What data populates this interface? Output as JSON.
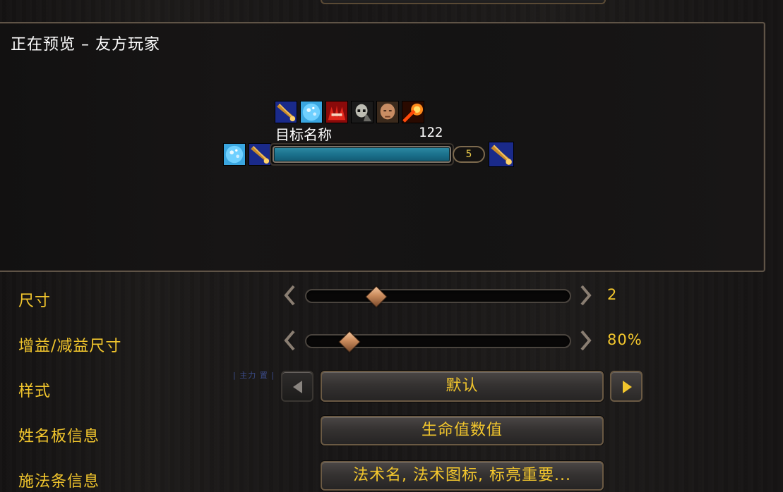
{
  "preview": {
    "title": "正在预览 – 友方玩家",
    "target_name": "目标名称",
    "target_level": "122",
    "stack_count": "5",
    "buff_icons": [
      "blue-staff-icon",
      "frost-orb-icon",
      "red-demon-icon",
      "armored-skull-icon",
      "bald-ogre-icon",
      "fire-burst-icon"
    ],
    "left_icons": [
      "frost-orb-icon",
      "blue-staff-icon"
    ],
    "right_icons": [
      "blue-staff-icon"
    ],
    "health_fill_fraction": 1.0,
    "health_color": "#1f7a96"
  },
  "settings": {
    "size": {
      "label": "尺寸",
      "value": "2"
    },
    "buff_size": {
      "label": "增益/减益尺寸",
      "value": "80%"
    },
    "style": {
      "label": "样式",
      "value": "默认",
      "tag": "| 主力 置 |"
    },
    "nameplate_info": {
      "label": "姓名板信息",
      "value": "生命值数值"
    },
    "cast_info": {
      "label": "施法条信息",
      "value": "法术名, 法术图标, 标亮重要..."
    }
  },
  "colors": {
    "accent_gold": "#f2c62d",
    "frame_bronze": "#6b5a44"
  }
}
